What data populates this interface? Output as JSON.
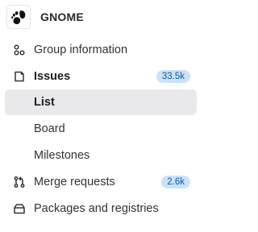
{
  "project": {
    "name": "GNOME",
    "logo_icon": "gnome-foot-icon"
  },
  "nav": {
    "group_information": {
      "label": "Group information",
      "icon": "group-icon"
    },
    "issues": {
      "label": "Issues",
      "icon": "issues-icon",
      "count": "33.5k"
    },
    "issues_list": {
      "label": "List"
    },
    "issues_board": {
      "label": "Board"
    },
    "issues_milestones": {
      "label": "Milestones"
    },
    "merge_requests": {
      "label": "Merge requests",
      "icon": "merge-request-icon",
      "count": "2.6k"
    },
    "packages": {
      "label": "Packages and registries",
      "icon": "package-icon"
    }
  },
  "colors": {
    "badge_bg": "#cbe2f9",
    "badge_text": "#0b5cad",
    "active_bg": "#e9e9ec"
  }
}
